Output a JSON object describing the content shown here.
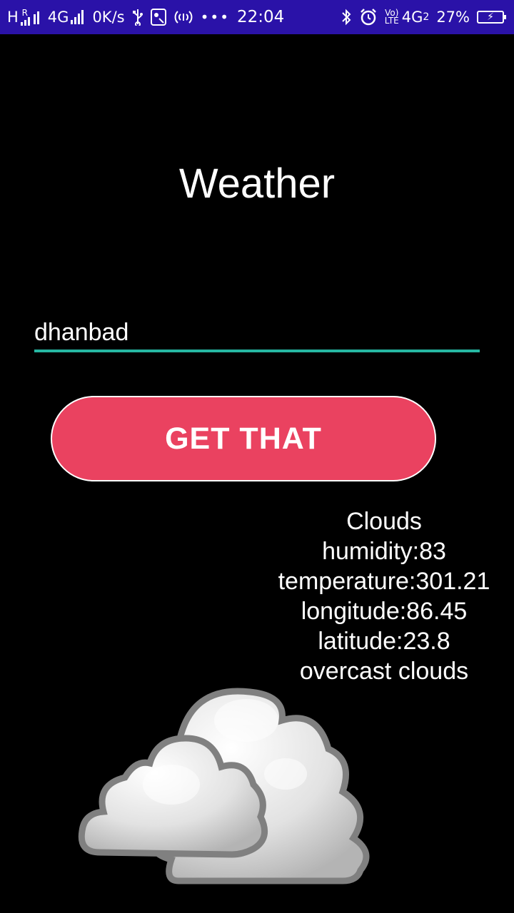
{
  "status_bar": {
    "network_h": "H",
    "network_r": "R",
    "network_4g": "4G",
    "speed": "0K/s",
    "time": "22:04",
    "volte_top": "Vo)",
    "volte_bottom": "LTE",
    "network_4g2": "4G",
    "sim2": "2",
    "battery": "27%"
  },
  "app": {
    "title": "Weather",
    "city_value": "dhanbad",
    "button_label": "GET THAT"
  },
  "results": {
    "main": "Clouds",
    "humidity": "humidity:83",
    "temperature": "temperature:301.21",
    "longitude": "longitude:86.45",
    "latitude": "latitude:23.8",
    "description": "overcast clouds"
  },
  "icons": {
    "weather": "overcast-clouds-icon"
  },
  "colors": {
    "status_bar": "#2a12a8",
    "button": "#ea4260",
    "input_underline": "#26b7a2",
    "background": "#000000"
  }
}
